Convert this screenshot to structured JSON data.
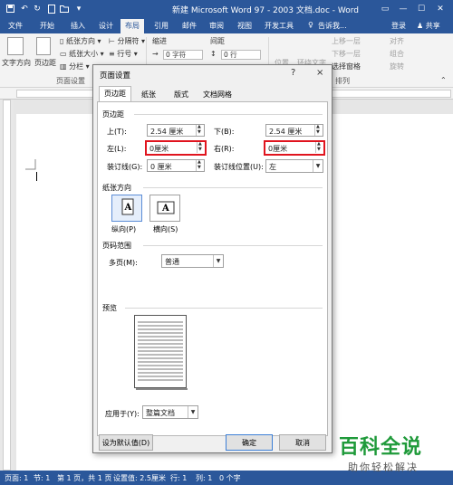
{
  "window": {
    "title": "新建 Microsoft Word 97 - 2003 文档.doc - Word",
    "tabs": [
      "文件",
      "开始",
      "插入",
      "设计",
      "布局",
      "引用",
      "邮件",
      "审阅",
      "视图",
      "开发工具"
    ],
    "tell_me": "告诉我...",
    "login": "登录",
    "share": "共享"
  },
  "ribbon": {
    "text_direction": "文字方向",
    "margins": "页边距",
    "orientation": "纸张方向",
    "size": "纸张大小",
    "columns": "分栏",
    "breaks": "分隔符",
    "line_numbers": "行号",
    "page_setup_group": "页面设置",
    "indent": "缩进",
    "spacing": "间距",
    "indent_left": "0 字符",
    "spacing_before": "0 行",
    "position": "位置",
    "wrap_text": "环绕文字",
    "bring_forward": "上移一层",
    "send_backward": "下移一层",
    "selection_pane": "选择窗格",
    "align": "对齐",
    "group": "组合",
    "rotate": "旋转",
    "arrange_group": "排列"
  },
  "dialog": {
    "title": "页面设置",
    "help": "?",
    "close": "×",
    "tabs": [
      "页边距",
      "纸张",
      "版式",
      "文档网格"
    ],
    "margins_group": "页边距",
    "top_label": "上(T):",
    "top_value": "2.54 厘米",
    "bottom_label": "下(B):",
    "bottom_value": "2.54 厘米",
    "left_label": "左(L):",
    "left_value": "0厘米",
    "right_label": "右(R):",
    "right_value": "0厘米",
    "gutter_label": "装订线(G):",
    "gutter_value": "0 厘米",
    "gutter_pos_label": "装订线位置(U):",
    "gutter_pos_value": "左",
    "orientation_group": "纸张方向",
    "portrait": "纵向(P)",
    "landscape": "横向(S)",
    "pages_group": "页码范围",
    "multiple_pages_label": "多页(M):",
    "multiple_pages_value": "普通",
    "preview_group": "预览",
    "apply_to_label": "应用于(Y):",
    "apply_to_value": "整篇文档",
    "set_default": "设为默认值(D)",
    "ok": "确定",
    "cancel": "取消"
  },
  "status": {
    "page": "页面: 1",
    "section": "节: 1",
    "page_of": "第 1 页，共 1 页",
    "at": "设置值: 2.5厘米",
    "line": "行: 1",
    "col": "列: 1",
    "words": "0 个字"
  },
  "watermark": {
    "big": "百科全说",
    "small": "助你轻松解决"
  },
  "colors": {
    "word_blue": "#2b579a",
    "highlight_red": "#e0141e",
    "watermark_green": "#1f9a3a"
  }
}
